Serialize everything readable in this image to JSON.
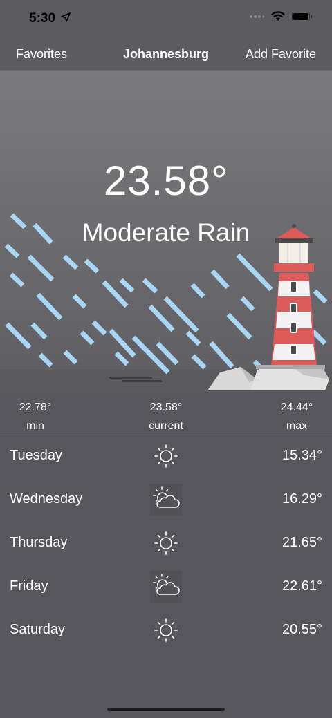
{
  "status_bar": {
    "time": "5:30"
  },
  "nav": {
    "left_label": "Favorites",
    "title": "Johannesburg",
    "right_label": "Add Favorite"
  },
  "current": {
    "temperature": "23.58°",
    "condition": "Moderate Rain"
  },
  "stats": [
    {
      "value": "22.78°",
      "label": "min"
    },
    {
      "value": "23.58°",
      "label": "current"
    },
    {
      "value": "24.44°",
      "label": "max"
    }
  ],
  "forecast": [
    {
      "day": "Tuesday",
      "icon": "sun-icon",
      "temp": "15.34°"
    },
    {
      "day": "Wednesday",
      "icon": "partly-cloudy-icon",
      "temp": "16.29°"
    },
    {
      "day": "Thursday",
      "icon": "sun-icon",
      "temp": "21.65°"
    },
    {
      "day": "Friday",
      "icon": "partly-cloudy-icon",
      "temp": "22.61°"
    },
    {
      "day": "Saturday",
      "icon": "sun-icon",
      "temp": "20.55°"
    }
  ],
  "colors": {
    "background": "#56565c",
    "rain": "#a9d6f5",
    "lighthouse_red": "#dd5b5b"
  }
}
